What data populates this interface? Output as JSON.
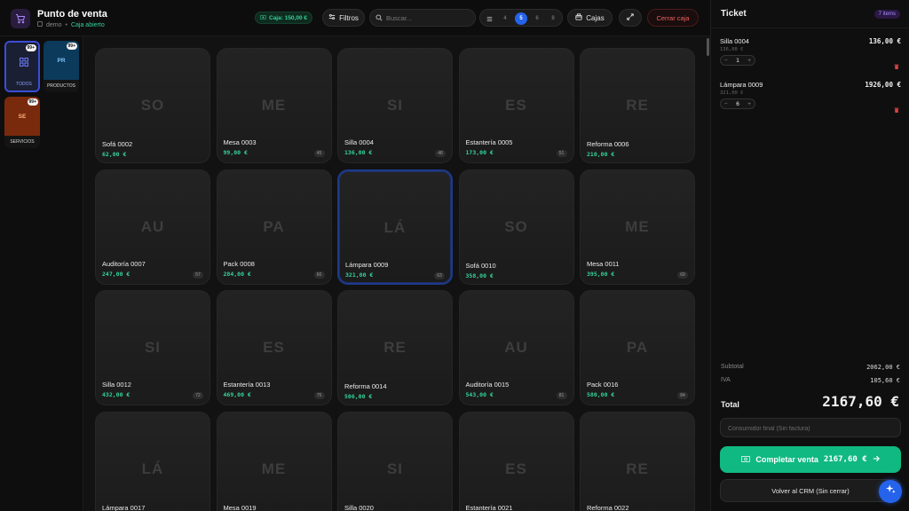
{
  "header": {
    "title": "Punto de venta",
    "company": "demo",
    "status": "Caja abierto",
    "caja_badge": "Caja: 150,00 €",
    "filters_label": "Filtros",
    "search_placeholder": "Buscar...",
    "zoom_levels": [
      "4",
      "5",
      "6",
      "8"
    ],
    "zoom_active": "5",
    "cajas_label": "Cajas",
    "close_register_label": "Cerrar caja"
  },
  "categories": [
    {
      "initials": "",
      "label": "TODOS",
      "count": "99+",
      "color": "#1a1f33",
      "selected": true
    },
    {
      "initials": "PR",
      "label": "PRODUCTOS",
      "count": "99+",
      "color": "#0c3a5a",
      "selected": false
    },
    {
      "initials": "SE",
      "label": "SERVICIOS",
      "count": "99+",
      "color": "#7a2a0c",
      "selected": false
    }
  ],
  "products": [
    {
      "initials": "SO",
      "name": "Sofá 0002",
      "price": "62,00 €",
      "stock": ""
    },
    {
      "initials": "ME",
      "name": "Mesa 0003",
      "price": "99,00 €",
      "stock": "45"
    },
    {
      "initials": "SI",
      "name": "Silla 0004",
      "price": "136,00 €",
      "stock": "48"
    },
    {
      "initials": "ES",
      "name": "Estantería 0005",
      "price": "173,00 €",
      "stock": "51"
    },
    {
      "initials": "RE",
      "name": "Reforma 0006",
      "price": "210,00 €",
      "stock": ""
    },
    {
      "initials": "AU",
      "name": "Auditoría 0007",
      "price": "247,00 €",
      "stock": "57"
    },
    {
      "initials": "PA",
      "name": "Pack 0008",
      "price": "284,00 €",
      "stock": "60"
    },
    {
      "initials": "LÁ",
      "name": "Lámpara 0009",
      "price": "321,00 €",
      "stock": "63",
      "selected": true
    },
    {
      "initials": "SO",
      "name": "Sofá 0010",
      "price": "358,00 €",
      "stock": ""
    },
    {
      "initials": "ME",
      "name": "Mesa 0011",
      "price": "395,00 €",
      "stock": "69"
    },
    {
      "initials": "SI",
      "name": "Silla 0012",
      "price": "432,00 €",
      "stock": "72"
    },
    {
      "initials": "ES",
      "name": "Estantería 0013",
      "price": "469,00 €",
      "stock": "75"
    },
    {
      "initials": "RE",
      "name": "Reforma 0014",
      "price": "506,00 €",
      "stock": ""
    },
    {
      "initials": "AU",
      "name": "Auditoría 0015",
      "price": "543,00 €",
      "stock": "81"
    },
    {
      "initials": "PA",
      "name": "Pack 0016",
      "price": "580,00 €",
      "stock": "84"
    },
    {
      "initials": "LÁ",
      "name": "Lámpara 0017",
      "price": "",
      "stock": ""
    },
    {
      "initials": "ME",
      "name": "Mesa 0019",
      "price": "",
      "stock": ""
    },
    {
      "initials": "SI",
      "name": "Silla 0020",
      "price": "",
      "stock": ""
    },
    {
      "initials": "ES",
      "name": "Estantería 0021",
      "price": "",
      "stock": ""
    },
    {
      "initials": "RE",
      "name": "Reforma 0022",
      "price": "",
      "stock": ""
    }
  ],
  "ticket": {
    "title": "Ticket",
    "items_count": "7 items",
    "lines": [
      {
        "name": "Silla 0004",
        "unit": "136,00 €",
        "qty": "1",
        "total": "136,00 €"
      },
      {
        "name": "Lámpara 0009",
        "unit": "321,00 €",
        "qty": "6",
        "total": "1926,00 €"
      }
    ],
    "subtotal_label": "Subtotal",
    "subtotal": "2062,00 €",
    "tax_label": "IVA",
    "tax": "105,60 €",
    "total_label": "Total",
    "total": "2167,60 €",
    "client_placeholder": "Consumidor final (Sin factura)",
    "complete_label": "Completar venta",
    "complete_amount": "2167,60 €",
    "back_label": "Volver al CRM (Sin cerrar)"
  }
}
